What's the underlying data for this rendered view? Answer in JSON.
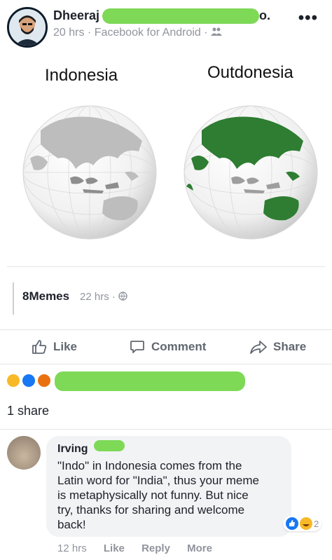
{
  "post": {
    "author_name": "Dheeraj",
    "author_tail": "o.",
    "time": "20 hrs",
    "source": "Facebook for Android",
    "more_label": "•••"
  },
  "meme": {
    "left_label": "Indonesia",
    "right_label": "Outdonesia",
    "left_color": "#9e9e9e",
    "right_color": "#2e7d32"
  },
  "shared_from": {
    "page_name": "8Memes",
    "time": "22 hrs"
  },
  "actions": {
    "like": "Like",
    "comment": "Comment",
    "share": "Share"
  },
  "share_count": "1 share",
  "comment": {
    "author": "Irving",
    "text": "\"Indo\" in Indonesia comes from the\nLatin word for \"India\", thus your meme\nis metaphysically not funny. But nice\ntry, thanks for sharing and welcome\nback!",
    "reaction_count": "2",
    "time": "12 hrs",
    "like": "Like",
    "reply": "Reply",
    "more": "More"
  }
}
